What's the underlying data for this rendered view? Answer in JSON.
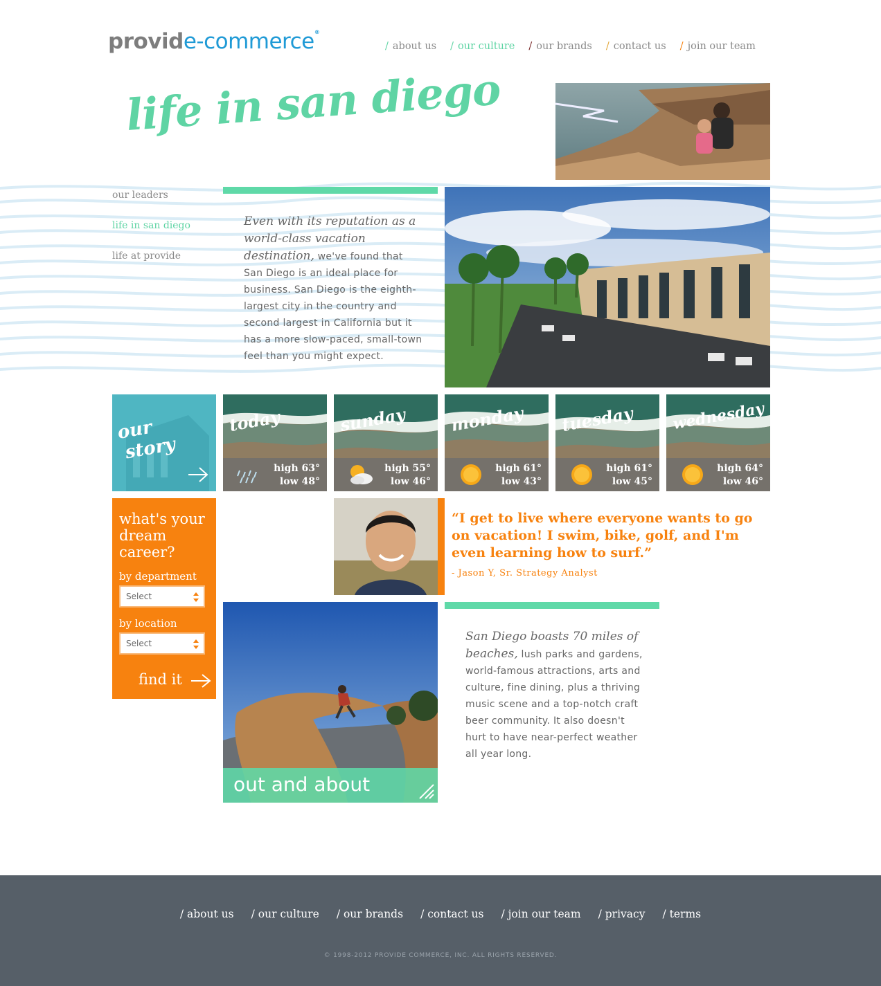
{
  "brand": {
    "logo_part1": "provid",
    "logo_part2": "e-commerce",
    "logo_reg": "®",
    "colors": {
      "green": "#5fd9a8",
      "orange": "#f7820f",
      "blue": "#1f9ad6",
      "footer": "#565f68"
    }
  },
  "topnav": {
    "items": [
      {
        "label": "about us",
        "slash_color": "#5fd4a4"
      },
      {
        "label": "our culture",
        "slash_color": "#5fd4a4",
        "active": true
      },
      {
        "label": "our brands",
        "slash_color": "#7a2a2a"
      },
      {
        "label": "contact us",
        "slash_color": "#e2a73a"
      },
      {
        "label": "join our team",
        "slash_color": "#f7820f"
      }
    ]
  },
  "hero": {
    "title": "life in san diego"
  },
  "sidenav": {
    "items": [
      {
        "label": "our leaders"
      },
      {
        "label": "life in san diego",
        "active": true
      },
      {
        "label": "life at provide"
      }
    ]
  },
  "intro": {
    "lead": "Even with its reputation as a world-class vacation destination,",
    "body": " we've found that San Diego is an ideal place for business. San Diego is the eighth-largest city in the country and second largest in California but it has a more slow-paced, small-town feel than you might expect."
  },
  "story_tile": {
    "line1": "our",
    "line2": "story"
  },
  "weather": [
    {
      "day": "today",
      "high": "high 63°",
      "low": "low 48°",
      "icon": "rain-icon"
    },
    {
      "day": "sunday",
      "high": "high 55°",
      "low": "low 46°",
      "icon": "partly-cloudy-icon"
    },
    {
      "day": "monday",
      "high": "high 61°",
      "low": "low 43°",
      "icon": "sun-icon"
    },
    {
      "day": "tuesday",
      "high": "high 61°",
      "low": "low 45°",
      "icon": "sun-icon"
    },
    {
      "day": "wednesday",
      "high": "high 64°",
      "low": "low 46°",
      "icon": "sun-icon"
    }
  ],
  "career": {
    "title": "what's your dream career?",
    "department_label": "by department",
    "department_value": "Select",
    "location_label": "by location",
    "location_value": "Select",
    "find_label": "find it"
  },
  "quote": {
    "text": "“I get to live where everyone wants to go on vacation! I swim, bike, golf, and I'm even learning how to surf.”",
    "author": "- Jason Y, Sr. Strategy Analyst"
  },
  "out_about": {
    "label": "out and about"
  },
  "beaches": {
    "lead": "San Diego boasts 70 miles of beaches,",
    "body": " lush parks and gardens, world-famous attractions, arts and culture, fine dining, plus a thriving music scene and a top-notch craft beer community. It also doesn't hurt to have near-perfect weather all year long."
  },
  "footer": {
    "items": [
      {
        "label": "/ about us"
      },
      {
        "label": "/ our culture"
      },
      {
        "label": "/ our brands"
      },
      {
        "label": "/ contact us"
      },
      {
        "label": "/ join our team"
      },
      {
        "label": "/ privacy"
      },
      {
        "label": "/ terms"
      }
    ],
    "copyright": "© 1998-2012 PROVIDE COMMERCE, INC. ALL RIGHTS RESERVED."
  }
}
